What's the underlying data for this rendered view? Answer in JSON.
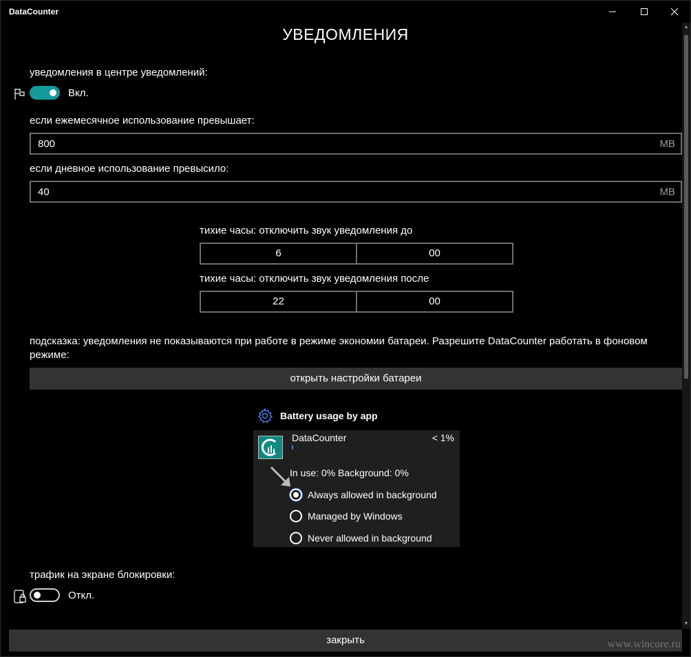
{
  "window": {
    "app_title": "DataCounter",
    "minimize_icon": "minimize-icon",
    "maximize_icon": "maximize-icon",
    "close_icon": "close-icon"
  },
  "page": {
    "title": "УВЕДОМЛЕНИЯ"
  },
  "notifications": {
    "label": "уведомления в центре уведомлений:",
    "icon": "flag-icon",
    "toggle_state": "Вкл.",
    "enabled": true
  },
  "monthly": {
    "label": "если ежемесячное использование превышает:",
    "value": "800",
    "unit": "MB"
  },
  "daily": {
    "label": "если дневное использование превысило:",
    "value": "40",
    "unit": "MB"
  },
  "quiet_hours": {
    "until_label": "тихие часы: отключить звук уведомления до",
    "until_hour": "6",
    "until_minute": "00",
    "after_label": "тихие часы: отключить звук уведомления после",
    "after_hour": "22",
    "after_minute": "00"
  },
  "hint": {
    "text": "подсказка: уведомления не показываются при работе в режиме экономии батареи. Разрешите DataCounter работать в фоновом режиме:",
    "button": "открыть настройки батареи"
  },
  "battery": {
    "header_icon": "gear-icon",
    "header": "Battery usage by app",
    "app_name": "DataCounter",
    "percent": "< 1%",
    "usage": "In use: 0%   Background: 0%",
    "options": [
      {
        "label": "Always allowed in background",
        "checked": true
      },
      {
        "label": "Managed by Windows",
        "checked": false
      },
      {
        "label": "Never allowed in background",
        "checked": false
      }
    ]
  },
  "lockscreen": {
    "label": "трафик на экране блокировки:",
    "icon": "lock-screen-icon",
    "toggle_state": "Откл.",
    "enabled": false
  },
  "footer": {
    "close_button": "закрыть"
  },
  "watermark": "www.wincore.ru",
  "colors": {
    "accent": "#159a9c",
    "background": "#000000",
    "button": "#333333"
  }
}
